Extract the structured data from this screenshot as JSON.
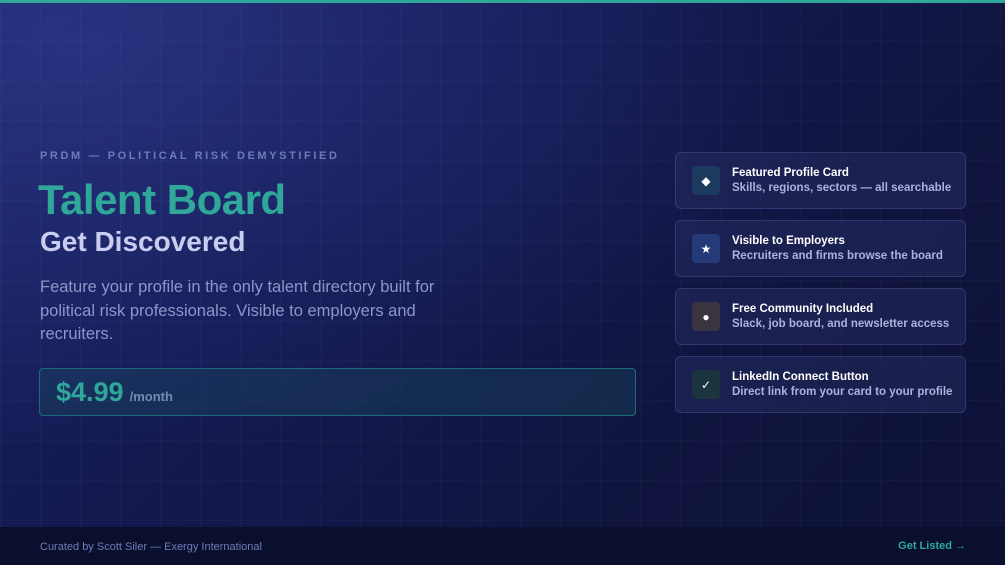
{
  "eyebrow": "PRDM — POLITICAL RISK DEMYSTIFIED",
  "title": "Talent Board",
  "subtitle": "Get Discovered",
  "description": "Feature your profile in the only talent directory built for political risk professionals. Visible to employers and recruiters.",
  "pricing": {
    "amount": "$4.99",
    "period": "/month"
  },
  "features": [
    {
      "icon": "diamond-icon",
      "glyph": "◆",
      "title": "Featured Profile Card",
      "description": "Skills, regions, sectors — all searchable"
    },
    {
      "icon": "star-icon",
      "glyph": "★",
      "title": "Visible to Employers",
      "description": "Recruiters and firms browse the board"
    },
    {
      "icon": "dot-icon",
      "glyph": "●",
      "title": "Free Community Included",
      "description": "Slack, job board, and newsletter access"
    },
    {
      "icon": "check-icon",
      "glyph": "✓",
      "title": "LinkedIn Connect Button",
      "description": "Direct link from your card to your profile"
    }
  ],
  "footer": {
    "credit": "Curated by Scott Siler — Exergy International",
    "cta": "Get Listed →"
  },
  "colors": {
    "accent": "#2fa89a",
    "background": "#141a52"
  }
}
